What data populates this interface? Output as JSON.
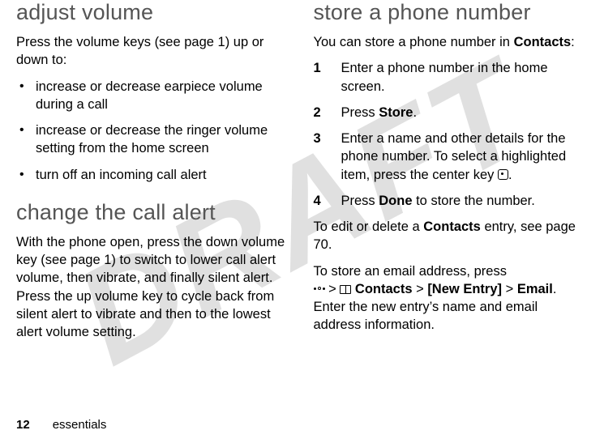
{
  "watermark": "DRAFT",
  "left": {
    "heading1": "adjust volume",
    "p1": "Press the volume keys (see page 1) up or down to:",
    "bullets": [
      "increase or decrease earpiece volume during a call",
      "increase or decrease the ringer volume setting from the home screen",
      "turn off an incoming call alert"
    ],
    "heading2": "change the call alert",
    "p2": "With the phone open, press the down volume key (see page 1) to switch to lower call alert volume, then vibrate, and finally silent alert. Press the up volume key to cycle back from silent alert to vibrate and then to the lowest alert volume setting."
  },
  "right": {
    "heading1": "store a phone number",
    "intro_a": "You can store a phone number in ",
    "intro_b": "Contacts",
    "intro_c": ":",
    "steps": {
      "s1": "Enter a phone number in the home screen.",
      "s2a": "Press ",
      "s2b": "Store",
      "s2c": ".",
      "s3a": "Enter a name and other details for the phone number. To select a highlighted item, press the center key ",
      "s3b": ".",
      "s4a": "Press ",
      "s4b": "Done",
      "s4c": " to store the number."
    },
    "after1a": "To edit or delete a ",
    "after1b": "Contacts",
    "after1c": " entry, see page 70.",
    "after2a": "To store an email address, press ",
    "after2_sep": " > ",
    "after2_contacts": "Contacts",
    "after2_newentry": "[New Entry]",
    "after2_email": "Email",
    "after2_tail": ". Enter the new entry’s name and email address information."
  },
  "footer": {
    "page": "12",
    "section": "essentials"
  }
}
